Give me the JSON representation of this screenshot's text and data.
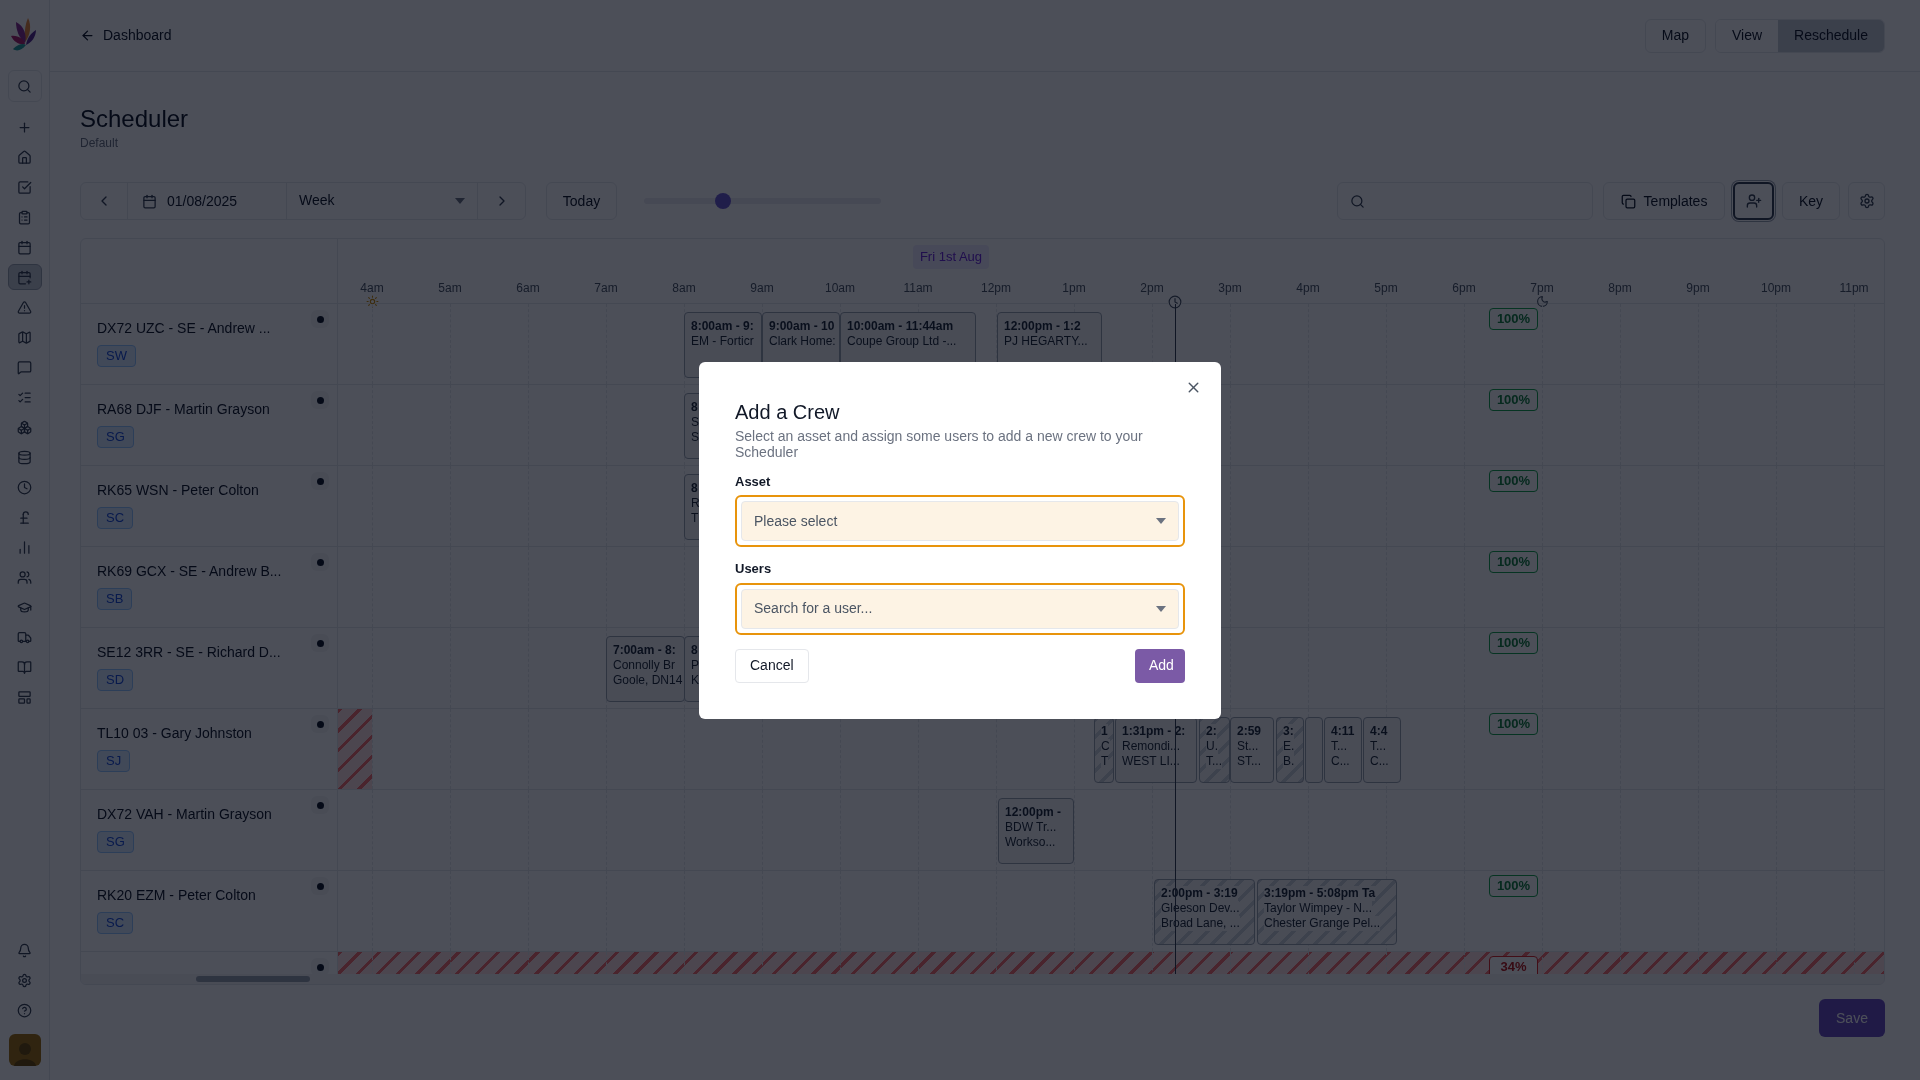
{
  "sidebar": {
    "items": [
      {
        "selected": false
      },
      {
        "selected": false
      },
      {
        "selected": false
      },
      {
        "selected": false
      },
      {
        "selected": true
      },
      {
        "selected": false
      },
      {
        "selected": false
      },
      {
        "selected": false
      },
      {
        "selected": false
      },
      {
        "selected": false
      },
      {
        "selected": false
      },
      {
        "selected": false
      },
      {
        "selected": false
      },
      {
        "selected": false
      },
      {
        "selected": false
      },
      {
        "selected": false
      },
      {
        "selected": false
      },
      {
        "selected": false
      },
      {
        "selected": false
      }
    ]
  },
  "top_bar": {
    "back_link": "Dashboard",
    "map_button": "Map",
    "view_toggle": [
      {
        "label": "View",
        "selected": false
      },
      {
        "label": "Reschedule",
        "selected": true
      }
    ]
  },
  "page": {
    "title": "Scheduler",
    "subtitle": "Default"
  },
  "toolbar": {
    "date": "01/08/2025",
    "period": "Week",
    "today": "Today",
    "zoom": {
      "level": 0.32
    },
    "templates": "Templates",
    "add_crew": {
      "selected": true
    },
    "key": "Key"
  },
  "timeline": {
    "day": "Fri 1st Aug",
    "hours": [
      "4am",
      "5am",
      "6am",
      "7am",
      "8am",
      "9am",
      "10am",
      "11am",
      "12pm",
      "1pm",
      "2pm",
      "3pm",
      "4pm",
      "5pm",
      "6pm",
      "7pm",
      "8pm",
      "9pm",
      "10pm",
      "11pm"
    ],
    "rows": [
      {
        "name": "DX72 UZC - SE - Andrew ...",
        "initials": "SW",
        "utilisation": "100%",
        "low": false,
        "unavailable_early": false,
        "unavailable": false,
        "events": [
          {
            "lines": [
              "8:00am - 9:",
              "EM - Forticr"
            ],
            "striped": false
          },
          {
            "lines": [
              "9:00am - 10",
              "Clark Home:"
            ],
            "striped": false
          },
          {
            "lines": [
              "10:00am - 11:44am",
              "Coupe Group Ltd -..."
            ],
            "striped": false
          },
          {
            "lines": [
              "12:00pm - 1:2",
              "PJ HEGARTY..."
            ],
            "striped": false
          }
        ]
      },
      {
        "name": "RA68 DJF - Martin Grayson",
        "initials": "SG",
        "utilisation": "100%",
        "low": false,
        "unavailable_early": false,
        "unavailable": false,
        "events": [
          {
            "lines": [
              "8",
              "S",
              "S"
            ],
            "striped": false
          }
        ]
      },
      {
        "name": "RK65 WSN - Peter Colton",
        "initials": "SC",
        "utilisation": "100%",
        "low": false,
        "unavailable_early": false,
        "unavailable": false,
        "events": [
          {
            "lines": [
              "8",
              "R",
              "T"
            ],
            "striped": false
          }
        ]
      },
      {
        "name": "RK69 GCX - SE - Andrew B...",
        "initials": "SB",
        "utilisation": "100%",
        "low": false,
        "unavailable_early": false,
        "unavailable": false,
        "events": []
      },
      {
        "name": "SE12 3RR - SE - Richard D...",
        "initials": "SD",
        "utilisation": "100%",
        "low": false,
        "unavailable_early": false,
        "unavailable": false,
        "events": [
          {
            "lines": [
              "7:00am - 8:",
              "Connolly Br",
              "Goole, DN14"
            ],
            "striped": false
          },
          {
            "lines": [
              "8",
              "P",
              "K"
            ],
            "striped": false
          }
        ]
      },
      {
        "name": "TL10 03 - Gary Johnston",
        "initials": "SJ",
        "utilisation": "100%",
        "low": false,
        "unavailable_early": true,
        "unavailable": false,
        "events": [
          {
            "lines": [
              "1",
              "C",
              "T"
            ],
            "striped": true
          },
          {
            "lines": [
              "1:31pm - 2:",
              "Remondi...",
              "WEST LI..."
            ],
            "striped": false
          },
          {
            "lines": [
              "2:",
              "U.",
              "T..."
            ],
            "striped": true
          },
          {
            "lines": [
              "2:59",
              "St...",
              "ST..."
            ],
            "striped": false
          },
          {
            "lines": [
              "3:",
              "E.",
              "B."
            ],
            "striped": true
          },
          {
            "striped": false
          },
          {
            "lines": [
              "4:11",
              "T...",
              "C..."
            ],
            "striped": false
          },
          {
            "lines": [
              "4:4",
              "T...",
              "C..."
            ],
            "striped": false
          }
        ]
      },
      {
        "name": "DX72 VAH - Martin Grayson",
        "initials": "SG",
        "events": [
          {
            "lines": [
              "12:00pm -",
              "BDW Tr...",
              "Workso..."
            ],
            "striped": false
          }
        ],
        "unavailable_early": false,
        "unavailable": false
      },
      {
        "name": "RK20 EZM - Peter Colton",
        "initials": "SC",
        "utilisation": "100%",
        "low": false,
        "unavailable_early": false,
        "unavailable": false,
        "events": [
          {
            "lines": [
              "2:00pm - 3:19",
              "Gleeson Dev...",
              "Broad Lane, ..."
            ],
            "striped": true
          },
          {
            "lines": [
              "3:19pm - 5:08pm Ta",
              "Taylor Wimpey - N...",
              "Chester Grange Pel..."
            ],
            "striped": true
          }
        ]
      },
      {
        "utilisation": "34%",
        "low": true,
        "unavailable_early": false,
        "unavailable": true,
        "events": []
      }
    ]
  },
  "save_button": "Save",
  "modal": {
    "title": "Add a Crew",
    "description": "Select an asset and assign some users to add a new crew to your Scheduler",
    "fields": [
      {
        "label": "Asset",
        "placeholder": "Please select",
        "highlighted": true
      },
      {
        "label": "Users",
        "placeholder": "Search for a user...",
        "highlighted": true
      }
    ],
    "buttons": [
      {
        "label": "Cancel",
        "kind": "secondary"
      },
      {
        "label": "Add",
        "kind": "primary"
      }
    ]
  }
}
